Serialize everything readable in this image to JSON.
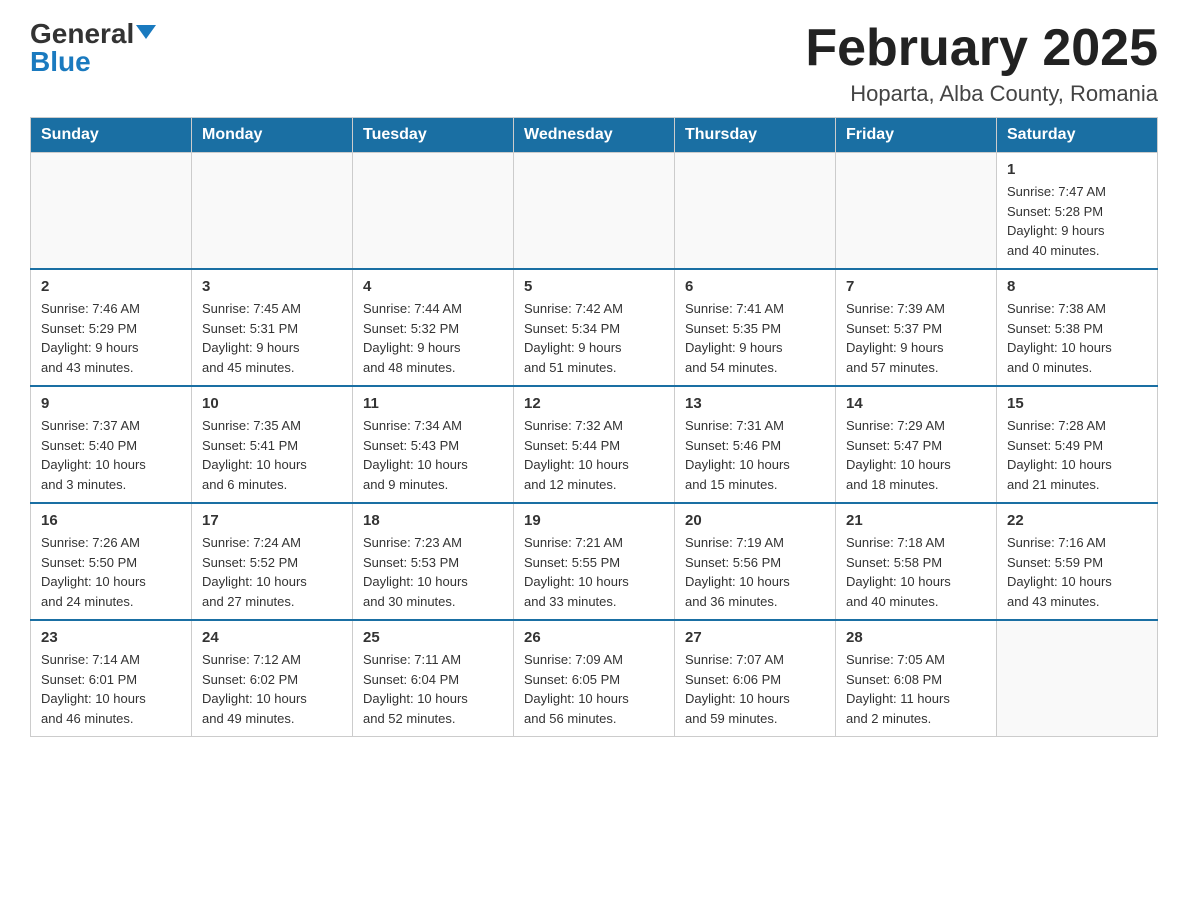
{
  "logo": {
    "general": "General",
    "blue": "Blue",
    "triangle": "▲"
  },
  "header": {
    "month": "February 2025",
    "location": "Hoparta, Alba County, Romania"
  },
  "weekdays": [
    "Sunday",
    "Monday",
    "Tuesday",
    "Wednesday",
    "Thursday",
    "Friday",
    "Saturday"
  ],
  "weeks": [
    [
      {
        "day": "",
        "info": ""
      },
      {
        "day": "",
        "info": ""
      },
      {
        "day": "",
        "info": ""
      },
      {
        "day": "",
        "info": ""
      },
      {
        "day": "",
        "info": ""
      },
      {
        "day": "",
        "info": ""
      },
      {
        "day": "1",
        "info": "Sunrise: 7:47 AM\nSunset: 5:28 PM\nDaylight: 9 hours\nand 40 minutes."
      }
    ],
    [
      {
        "day": "2",
        "info": "Sunrise: 7:46 AM\nSunset: 5:29 PM\nDaylight: 9 hours\nand 43 minutes."
      },
      {
        "day": "3",
        "info": "Sunrise: 7:45 AM\nSunset: 5:31 PM\nDaylight: 9 hours\nand 45 minutes."
      },
      {
        "day": "4",
        "info": "Sunrise: 7:44 AM\nSunset: 5:32 PM\nDaylight: 9 hours\nand 48 minutes."
      },
      {
        "day": "5",
        "info": "Sunrise: 7:42 AM\nSunset: 5:34 PM\nDaylight: 9 hours\nand 51 minutes."
      },
      {
        "day": "6",
        "info": "Sunrise: 7:41 AM\nSunset: 5:35 PM\nDaylight: 9 hours\nand 54 minutes."
      },
      {
        "day": "7",
        "info": "Sunrise: 7:39 AM\nSunset: 5:37 PM\nDaylight: 9 hours\nand 57 minutes."
      },
      {
        "day": "8",
        "info": "Sunrise: 7:38 AM\nSunset: 5:38 PM\nDaylight: 10 hours\nand 0 minutes."
      }
    ],
    [
      {
        "day": "9",
        "info": "Sunrise: 7:37 AM\nSunset: 5:40 PM\nDaylight: 10 hours\nand 3 minutes."
      },
      {
        "day": "10",
        "info": "Sunrise: 7:35 AM\nSunset: 5:41 PM\nDaylight: 10 hours\nand 6 minutes."
      },
      {
        "day": "11",
        "info": "Sunrise: 7:34 AM\nSunset: 5:43 PM\nDaylight: 10 hours\nand 9 minutes."
      },
      {
        "day": "12",
        "info": "Sunrise: 7:32 AM\nSunset: 5:44 PM\nDaylight: 10 hours\nand 12 minutes."
      },
      {
        "day": "13",
        "info": "Sunrise: 7:31 AM\nSunset: 5:46 PM\nDaylight: 10 hours\nand 15 minutes."
      },
      {
        "day": "14",
        "info": "Sunrise: 7:29 AM\nSunset: 5:47 PM\nDaylight: 10 hours\nand 18 minutes."
      },
      {
        "day": "15",
        "info": "Sunrise: 7:28 AM\nSunset: 5:49 PM\nDaylight: 10 hours\nand 21 minutes."
      }
    ],
    [
      {
        "day": "16",
        "info": "Sunrise: 7:26 AM\nSunset: 5:50 PM\nDaylight: 10 hours\nand 24 minutes."
      },
      {
        "day": "17",
        "info": "Sunrise: 7:24 AM\nSunset: 5:52 PM\nDaylight: 10 hours\nand 27 minutes."
      },
      {
        "day": "18",
        "info": "Sunrise: 7:23 AM\nSunset: 5:53 PM\nDaylight: 10 hours\nand 30 minutes."
      },
      {
        "day": "19",
        "info": "Sunrise: 7:21 AM\nSunset: 5:55 PM\nDaylight: 10 hours\nand 33 minutes."
      },
      {
        "day": "20",
        "info": "Sunrise: 7:19 AM\nSunset: 5:56 PM\nDaylight: 10 hours\nand 36 minutes."
      },
      {
        "day": "21",
        "info": "Sunrise: 7:18 AM\nSunset: 5:58 PM\nDaylight: 10 hours\nand 40 minutes."
      },
      {
        "day": "22",
        "info": "Sunrise: 7:16 AM\nSunset: 5:59 PM\nDaylight: 10 hours\nand 43 minutes."
      }
    ],
    [
      {
        "day": "23",
        "info": "Sunrise: 7:14 AM\nSunset: 6:01 PM\nDaylight: 10 hours\nand 46 minutes."
      },
      {
        "day": "24",
        "info": "Sunrise: 7:12 AM\nSunset: 6:02 PM\nDaylight: 10 hours\nand 49 minutes."
      },
      {
        "day": "25",
        "info": "Sunrise: 7:11 AM\nSunset: 6:04 PM\nDaylight: 10 hours\nand 52 minutes."
      },
      {
        "day": "26",
        "info": "Sunrise: 7:09 AM\nSunset: 6:05 PM\nDaylight: 10 hours\nand 56 minutes."
      },
      {
        "day": "27",
        "info": "Sunrise: 7:07 AM\nSunset: 6:06 PM\nDaylight: 10 hours\nand 59 minutes."
      },
      {
        "day": "28",
        "info": "Sunrise: 7:05 AM\nSunset: 6:08 PM\nDaylight: 11 hours\nand 2 minutes."
      },
      {
        "day": "",
        "info": ""
      }
    ]
  ]
}
